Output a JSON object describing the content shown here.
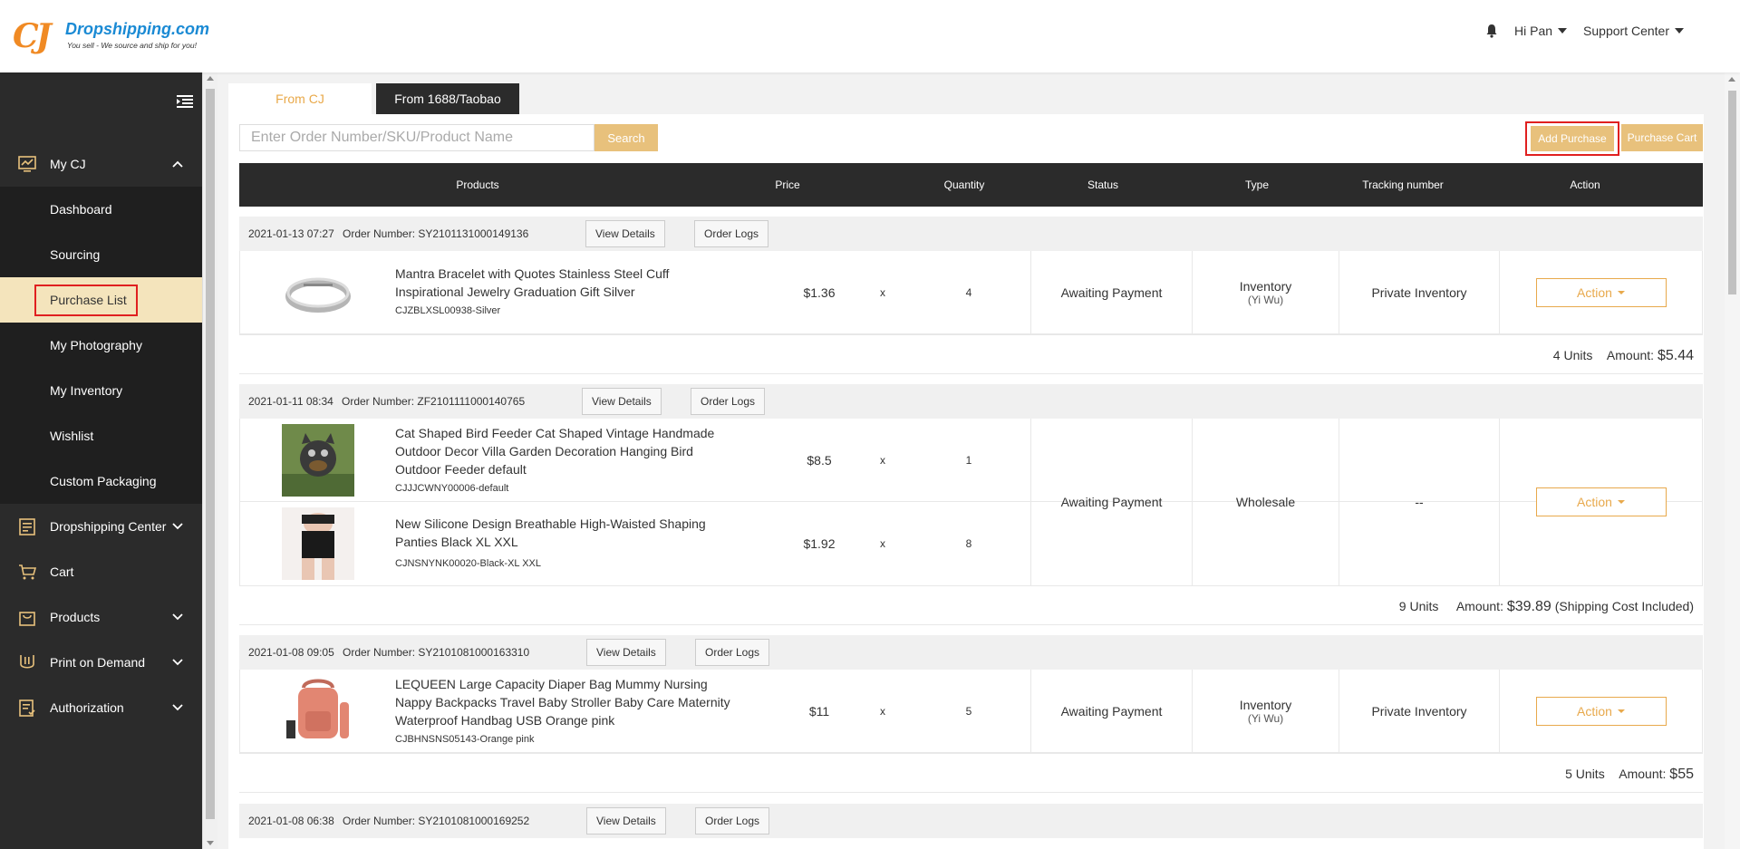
{
  "header": {
    "logo_mark": "CJ",
    "logo_brand": "Dropshipping.com",
    "logo_tagline": "You sell - We source and ship for you!",
    "user": "Hi Pan",
    "support": "Support Center",
    "icons": [
      "bell-icon",
      "caret-down-icon"
    ]
  },
  "sidebar": {
    "my_cj": "My CJ",
    "sub_items": [
      "Dashboard",
      "Sourcing",
      "Purchase List",
      "My Photography",
      "My Inventory",
      "Wishlist",
      "Custom Packaging"
    ],
    "active": "Purchase List",
    "menu": [
      "Dropshipping Center",
      "Cart",
      "Products",
      "Print on Demand",
      "Authorization"
    ]
  },
  "tabs": [
    "From CJ",
    "From 1688/Taobao"
  ],
  "search": {
    "placeholder": "Enter Order Number/SKU/Product Name",
    "button": "Search"
  },
  "toolbar": {
    "add_purchase": "Add Purchase",
    "purchase_cart": "Purchase Cart"
  },
  "table_headers": [
    "Products",
    "Price",
    "Quantity",
    "Status",
    "Type",
    "Tracking number",
    "Action"
  ],
  "buttons": {
    "view_details": "View Details",
    "order_logs": "Order Logs",
    "action": "Action"
  },
  "labels": {
    "x": "x",
    "order_number_prefix": "Order Number: ",
    "amount": "Amount: "
  },
  "orders": [
    {
      "date": "2021-01-13 07:27",
      "order_number": "SY2101131000149136",
      "products": [
        {
          "title": "Mantra Bracelet with Quotes Stainless Steel Cuff Inspirational Jewelry Graduation Gift Silver",
          "sku": "CJZBLXSL00938-Silver",
          "price": "$1.36",
          "qty": "4"
        }
      ],
      "status": "Awaiting Payment",
      "type": "Inventory",
      "type_sub": "(Yi Wu)",
      "tracking": "Private Inventory",
      "units": "4 Units",
      "amount": "$5.44",
      "note": ""
    },
    {
      "date": "2021-01-11 08:34",
      "order_number": "ZF2101111000140765",
      "products": [
        {
          "title": "Cat Shaped Bird Feeder Cat Shaped Vintage Handmade Outdoor Decor Villa Garden Decoration Hanging Bird Outdoor Feeder default",
          "sku": "CJJJCWNY00006-default",
          "price": "$8.5",
          "qty": "1"
        },
        {
          "title": "New Silicone Design Breathable High-Waisted Shaping Panties Black XL XXL",
          "sku": "CJNSNYNK00020-Black-XL XXL",
          "price": "$1.92",
          "qty": "8"
        }
      ],
      "status": "Awaiting Payment",
      "type": "Wholesale",
      "type_sub": "",
      "tracking": "--",
      "units": "9 Units",
      "amount": "$39.89",
      "note": "(Shipping Cost Included)"
    },
    {
      "date": "2021-01-08 09:05",
      "order_number": "SY2101081000163310",
      "products": [
        {
          "title": "LEQUEEN Large Capacity Diaper Bag Mummy Nursing Nappy Backpacks Travel Baby Stroller Baby Care Maternity Waterproof Handbag USB Orange pink",
          "sku": "CJBHNSNS05143-Orange pink",
          "price": "$11",
          "qty": "5"
        }
      ],
      "status": "Awaiting Payment",
      "type": "Inventory",
      "type_sub": "(Yi Wu)",
      "tracking": "Private Inventory",
      "units": "5 Units",
      "amount": "$55",
      "note": ""
    },
    {
      "date": "2021-01-08 06:38",
      "order_number": "SY2101081000169252"
    }
  ],
  "colors": {
    "accent": "#e8c17c",
    "accent_text": "#e8a94c",
    "dark": "#2b2b2b",
    "highlight_box": "#e02020"
  }
}
